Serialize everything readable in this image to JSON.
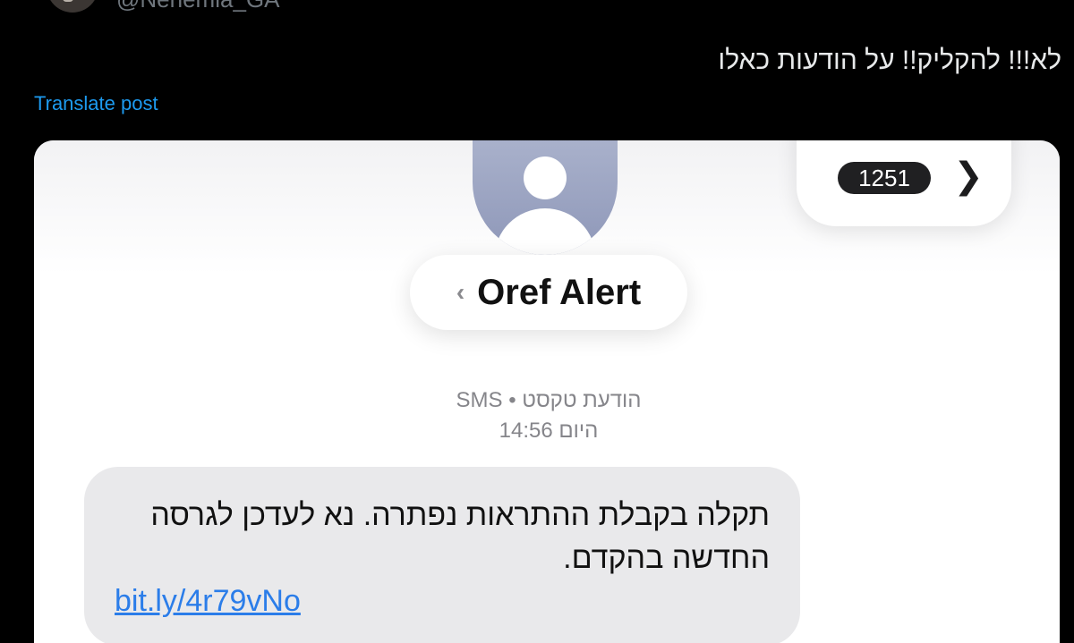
{
  "post": {
    "handle": "@Nehemia_GA",
    "text": "לא!!! להקליק!! על הודעות כאלו",
    "translate_label": "Translate post"
  },
  "screenshot": {
    "contact_name": "Oref Alert",
    "unread_count": "1251",
    "meta_line1": "הודעת טקסט • SMS",
    "meta_line2": "היום 14:56",
    "message_text": "תקלה בקבלת ההתראות נפתרה. נא לעדכן לגרסה החדשה בהקדם.",
    "message_link": "bit.ly/4r79vNo",
    "icons": {
      "back": "chevron-left-icon",
      "forward": "chevron-right-icon",
      "contact": "person-avatar-icon"
    }
  },
  "colors": {
    "background": "#000000",
    "link": "#1d9bf0",
    "bubble": "#e9e9eb",
    "sms_link": "#2b7de9"
  }
}
